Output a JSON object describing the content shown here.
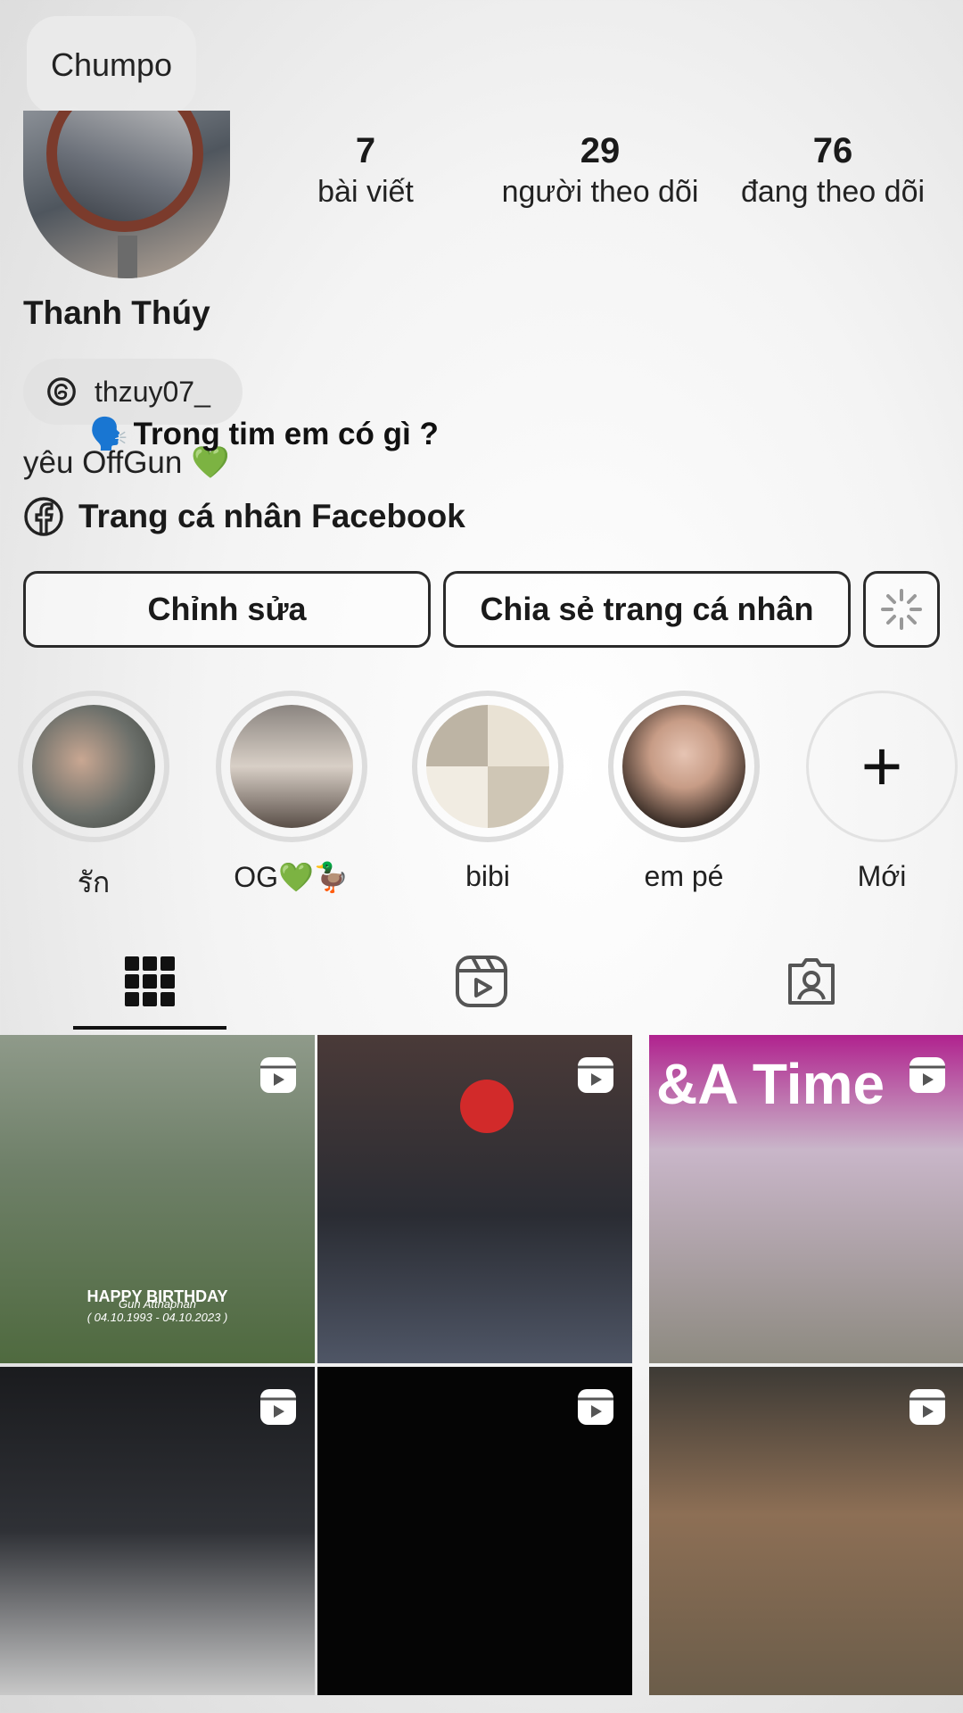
{
  "note": {
    "text": "Chumpo"
  },
  "profile": {
    "name": "Thanh Thúy",
    "threads_handle": "thzuy07_",
    "sticker_text": "Trong tim em có gì ?",
    "sticker_emoji": "🗣️",
    "bio": "yêu OffGun 💚",
    "facebook_link": "Trang cá nhân Facebook"
  },
  "stats": [
    {
      "value": "7",
      "label": "bài viết"
    },
    {
      "value": "29",
      "label": "người theo dõi"
    },
    {
      "value": "76",
      "label": "đang theo dõi"
    }
  ],
  "buttons": {
    "edit": "Chỉnh sửa",
    "share": "Chia sẻ trang cá nhân"
  },
  "highlights": [
    {
      "label": "รัก",
      "color": "#6b6f6a"
    },
    {
      "label": "OG💚🦆",
      "color": "#a9a29b"
    },
    {
      "label": "bibi",
      "color": "#d8d2c6"
    },
    {
      "label": "em pé",
      "color": "#7a6656"
    },
    {
      "label": "Mới",
      "icon": "plus-icon"
    }
  ],
  "tabs": [
    "grid-icon",
    "reels-icon",
    "tagged-icon"
  ],
  "grid": [
    {
      "bg": "#6f8069",
      "caption": "HAPPY BIRTHDAY",
      "subcaption": "Gun Atthaphan",
      "subcaption2": "( 04.10.1993 - 04.10.2023 )"
    },
    {
      "bg": "#2a2c33"
    },
    {
      "bg": "#c9b6c9",
      "headline": "&A Time"
    },
    {
      "bg": "#2f3136"
    },
    {
      "bg": "#050505"
    },
    {
      "bg": "#6b5d4a"
    }
  ]
}
